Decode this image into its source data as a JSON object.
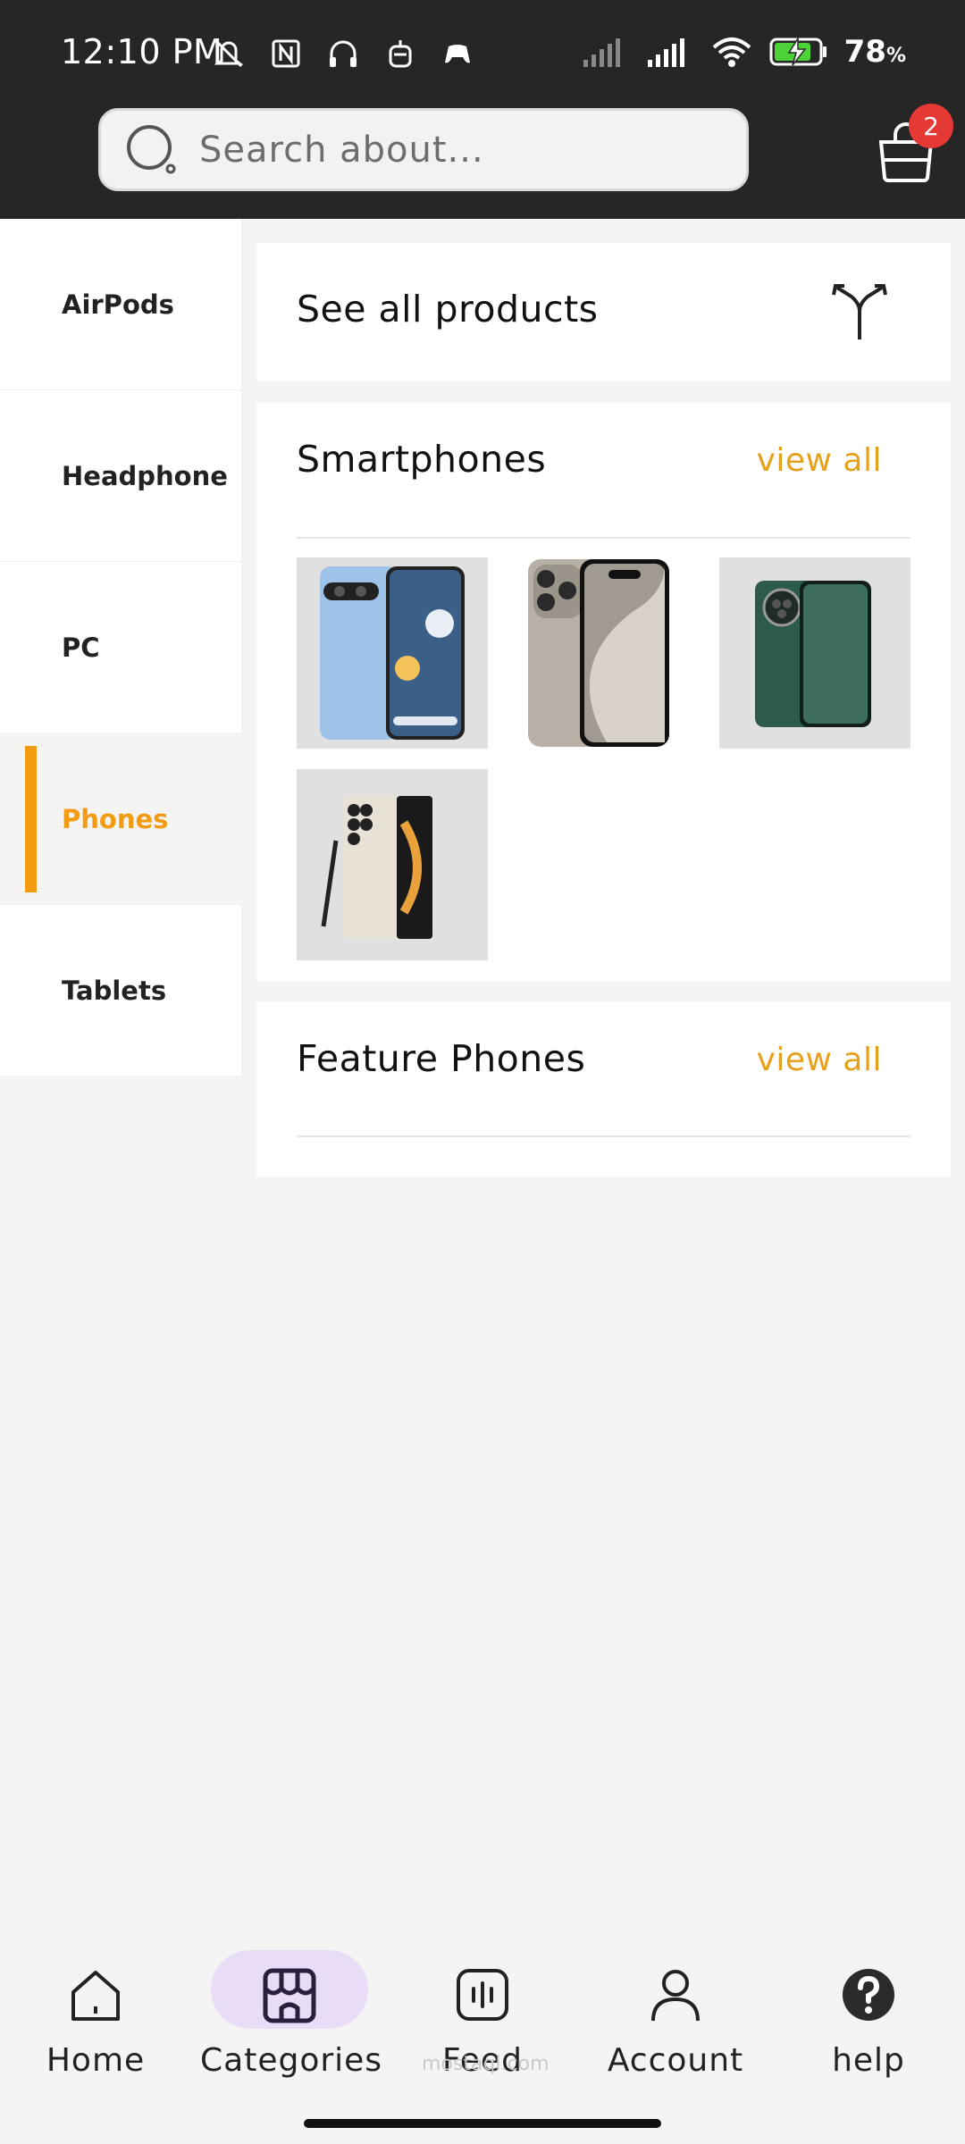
{
  "status_bar": {
    "time": "12:10 PM",
    "battery": "78",
    "battery_unit": "%"
  },
  "search": {
    "placeholder": "Search about..."
  },
  "cart": {
    "badge_count": "2",
    "icon": "shopping-bag-icon"
  },
  "sidebar": {
    "items": [
      {
        "label": "AirPods",
        "active": false
      },
      {
        "label": "Headphone",
        "active": false
      },
      {
        "label": "PC",
        "active": false
      },
      {
        "label": "Phones",
        "active": true
      },
      {
        "label": "Tablets",
        "active": false
      }
    ]
  },
  "see_all": {
    "label": "See all products",
    "icon": "fork-arrows-icon"
  },
  "sections": [
    {
      "title": "Smartphones",
      "view_all": "view all",
      "products": [
        "google-pixel-phone",
        "iphone-titanium",
        "oneplus-green-phone",
        "samsung-galaxy-ultra"
      ]
    },
    {
      "title": "Feature Phones",
      "view_all": "view all",
      "products": []
    }
  ],
  "bottom_nav": [
    {
      "label": "Home",
      "icon": "home-icon"
    },
    {
      "label": "Categories",
      "icon": "store-icon",
      "active": true
    },
    {
      "label": "Feed",
      "icon": "feed-icon"
    },
    {
      "label": "Account",
      "icon": "person-icon"
    },
    {
      "label": "help",
      "icon": "help-icon"
    }
  ],
  "watermark": "mostaql.com",
  "colors": {
    "accent": "#f39c12",
    "header": "#262626",
    "badge": "#e53935",
    "active_pill": "#e8dcf6"
  }
}
